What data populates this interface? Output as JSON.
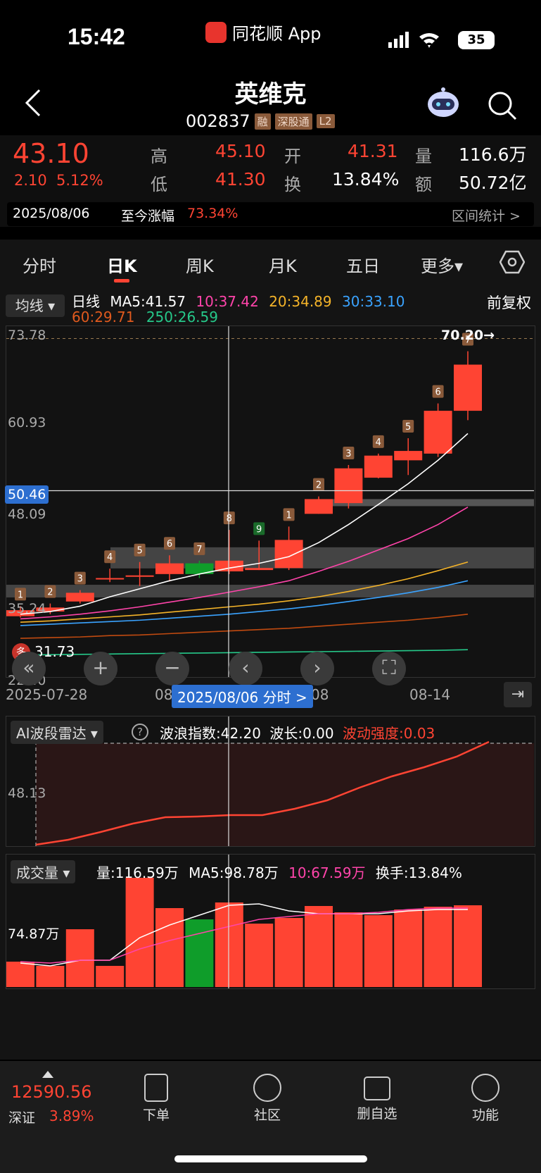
{
  "status": {
    "time": "15:42",
    "app_name": "同花顺 App",
    "battery": "35"
  },
  "header": {
    "name": "英维克",
    "code": "002837",
    "tags": [
      "融",
      "深股通",
      "L2"
    ]
  },
  "quote": {
    "price": "43.10",
    "change": "2.10",
    "change_pct": "5.12%",
    "high_label": "高",
    "high": "45.10",
    "low_label": "低",
    "low": "41.30",
    "open_label": "开",
    "open": "41.31",
    "turnover_label": "换",
    "turnover": "13.84%",
    "volume_label": "量",
    "volume": "116.6万",
    "amount_label": "额",
    "amount": "50.72亿",
    "date": "2025/08/06",
    "gain_label": "至今涨幅",
    "gain": "73.34%",
    "range_stats": "区间统计 >"
  },
  "tabs": [
    "分时",
    "日K",
    "周K",
    "月K",
    "五日",
    "更多▾"
  ],
  "kline": {
    "ma_button": "均线 ▾",
    "line_label": "日线",
    "ma5": "MA5:41.57",
    "ma10": "10:37.42",
    "ma20": "20:34.89",
    "ma30": "30:33.10",
    "ma60": "60:29.71",
    "ma250": "250:26.59",
    "adjust": "前复权",
    "y_labels": [
      "73.78",
      "60.93",
      "48.09",
      "35.24",
      "22.40"
    ],
    "crosshair_price": "50.46",
    "max_label": "70.20→",
    "min_label": "31.73",
    "multi_badge": "多",
    "date_start": "2025-07-28",
    "date_mid": "08",
    "date_mid2": "08",
    "date_end": "08-14",
    "crosshair_date": "2025/08/06 分时 >",
    "seq_labels": [
      "1",
      "2",
      "3",
      "4",
      "5",
      "6",
      "7",
      "8",
      "9",
      "1",
      "2",
      "3",
      "4",
      "5",
      "6",
      "7"
    ]
  },
  "radar": {
    "button": "AI波段雷达 ▾",
    "help": "?",
    "wave_index": "波浪指数:42.20",
    "wave_len": "波长:0.00",
    "volatility": "波动强度:0.03",
    "y_label": "48.13"
  },
  "volume_panel": {
    "button": "成交量 ▾",
    "vol": "量:116.59万",
    "ma5": "MA5:98.78万",
    "ma10": "10:67.59万",
    "turnover": "换手:13.84%",
    "y_label": "74.87万"
  },
  "bottom": {
    "index_value": "12590.56",
    "index_name": "深证",
    "index_pct": "3.89%",
    "items": [
      "下单",
      "社区",
      "删自选",
      "功能"
    ]
  },
  "colors": {
    "up": "#ff4433",
    "down": "#0f9d2a",
    "ma5": "#ffffff",
    "ma10": "#ff44aa",
    "ma20": "#f5b429",
    "ma30": "#3aa3ff",
    "ma60": "#c04a10",
    "ma250": "#26c98a"
  }
}
